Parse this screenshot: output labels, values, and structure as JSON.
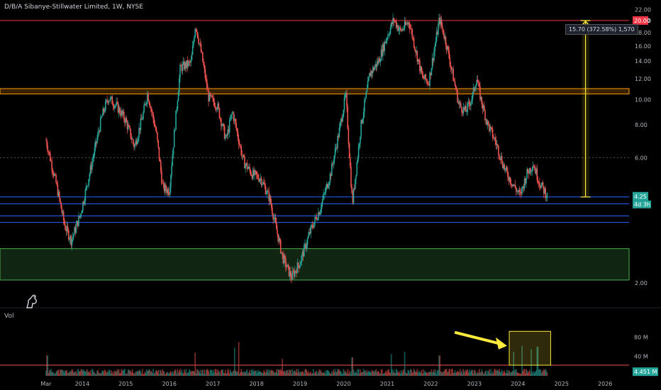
{
  "header": {
    "title": "D/B/A Sibanye-Stillwater Limited, 1W, NYSE"
  },
  "volume_label": "Vol",
  "measure_label": "15.70 (372.58%) 1,570",
  "colors": {
    "background": "#000000",
    "up": "#26a69a",
    "down": "#ef5350",
    "resistance_top": "#f23645",
    "orange_zone": "#ff9800",
    "blue_lines": "#2962ff",
    "green_zone": "#4caf50",
    "arrow": "#ffeb3b",
    "volume_box": "#ffeb3b"
  },
  "chart_data": [
    {
      "type": "candlestick",
      "title": "",
      "x_ticks": [
        "Mar",
        "2014",
        "2015",
        "2016",
        "2017",
        "2018",
        "2019",
        "2020",
        "2021",
        "2022",
        "2023",
        "2024",
        "2025",
        "2026"
      ],
      "x_tick_dates": [
        2013.17,
        2014.0,
        2015.0,
        2016.0,
        2017.0,
        2018.0,
        2019.0,
        2020.0,
        2021.0,
        2022.0,
        2023.0,
        2024.0,
        2025.0,
        2026.0
      ],
      "y_ticks": [
        "22.00",
        "20.00",
        "18.00",
        "16.00",
        "14.00",
        "12.00",
        "10.00",
        "8.00",
        "6.00",
        "4.00",
        "2.00"
      ],
      "y_scale": "log",
      "ylim": [
        1.7,
        22.5
      ],
      "last_price_label": "4.25",
      "countdown_label": "4d 3h",
      "target_label": "20.00",
      "price_path": [
        [
          2013.17,
          7.0
        ],
        [
          2013.4,
          4.8
        ],
        [
          2013.6,
          3.3
        ],
        [
          2013.75,
          2.9
        ],
        [
          2013.95,
          3.6
        ],
        [
          2014.2,
          5.5
        ],
        [
          2014.45,
          8.6
        ],
        [
          2014.6,
          10.2
        ],
        [
          2014.8,
          9.4
        ],
        [
          2015.0,
          8.3
        ],
        [
          2015.2,
          6.6
        ],
        [
          2015.4,
          8.8
        ],
        [
          2015.5,
          10.6
        ],
        [
          2015.7,
          7.5
        ],
        [
          2015.85,
          4.6
        ],
        [
          2016.0,
          4.5
        ],
        [
          2016.1,
          7.0
        ],
        [
          2016.25,
          13.2
        ],
        [
          2016.5,
          13.8
        ],
        [
          2016.6,
          19.5
        ],
        [
          2016.75,
          14.5
        ],
        [
          2016.9,
          10.2
        ],
        [
          2017.1,
          9.5
        ],
        [
          2017.3,
          7.0
        ],
        [
          2017.45,
          9.0
        ],
        [
          2017.7,
          5.8
        ],
        [
          2017.9,
          5.2
        ],
        [
          2018.1,
          5.0
        ],
        [
          2018.3,
          4.2
        ],
        [
          2018.6,
          2.5
        ],
        [
          2018.8,
          2.1
        ],
        [
          2019.0,
          2.4
        ],
        [
          2019.25,
          3.2
        ],
        [
          2019.45,
          3.8
        ],
        [
          2019.7,
          5.2
        ],
        [
          2019.9,
          7.6
        ],
        [
          2020.05,
          10.5
        ],
        [
          2020.2,
          4.0
        ],
        [
          2020.4,
          8.0
        ],
        [
          2020.6,
          12.5
        ],
        [
          2020.8,
          14.0
        ],
        [
          2021.0,
          17.5
        ],
        [
          2021.15,
          20.2
        ],
        [
          2021.3,
          18.2
        ],
        [
          2021.5,
          19.8
        ],
        [
          2021.65,
          15.5
        ],
        [
          2021.8,
          12.2
        ],
        [
          2021.95,
          11.6
        ],
        [
          2022.05,
          14.5
        ],
        [
          2022.2,
          20.3
        ],
        [
          2022.35,
          16.5
        ],
        [
          2022.5,
          12.5
        ],
        [
          2022.65,
          9.5
        ],
        [
          2022.8,
          9.0
        ],
        [
          2022.95,
          10.2
        ],
        [
          2023.05,
          12.1
        ],
        [
          2023.15,
          10.0
        ],
        [
          2023.3,
          8.1
        ],
        [
          2023.5,
          6.8
        ],
        [
          2023.7,
          5.4
        ],
        [
          2023.9,
          4.7
        ],
        [
          2024.05,
          4.3
        ],
        [
          2024.2,
          5.2
        ],
        [
          2024.35,
          5.7
        ],
        [
          2024.5,
          4.8
        ],
        [
          2024.6,
          4.5
        ],
        [
          2024.68,
          4.25
        ]
      ],
      "horizontal_zones": [
        {
          "name": "resistance-top",
          "low": 20.0,
          "high": 20.0,
          "color": "#f23645"
        },
        {
          "name": "orange-zone",
          "low": 10.5,
          "high": 11.0,
          "color": "#ff9800"
        },
        {
          "name": "blue-line-1",
          "low": 4.25,
          "high": 4.25,
          "color": "#2962ff"
        },
        {
          "name": "blue-line-2",
          "low": 4.0,
          "high": 4.0,
          "color": "#2962ff"
        },
        {
          "name": "blue-line-3",
          "low": 3.6,
          "high": 3.6,
          "color": "#2962ff"
        },
        {
          "name": "blue-line-4",
          "low": 3.4,
          "high": 3.4,
          "color": "#2962ff"
        },
        {
          "name": "green-zone",
          "low": 2.05,
          "high": 2.7,
          "color": "#4caf50"
        }
      ],
      "dashed_level": 6.0,
      "measure": {
        "x": 2025.55,
        "from": 4.25,
        "to": 20.0
      }
    },
    {
      "type": "bar",
      "title": "",
      "y_ticks": [
        "80 M",
        "40 M"
      ],
      "ylim": [
        0,
        110
      ],
      "last_volume_label": "4.451 M",
      "volume_level_line": 22,
      "highlight_box": {
        "x_from": 2023.8,
        "x_to": 2024.75,
        "y_from": 22,
        "y_to": 92
      },
      "arrow": {
        "from_x": 2022.55,
        "from_y": 90,
        "to_x": 2023.75,
        "to_y": 62
      },
      "spikes": [
        [
          2013.2,
          42
        ],
        [
          2016.6,
          48
        ],
        [
          2017.5,
          58
        ],
        [
          2017.6,
          70
        ],
        [
          2018.6,
          35
        ],
        [
          2020.2,
          38
        ],
        [
          2021.1,
          45
        ],
        [
          2021.4,
          50
        ],
        [
          2022.2,
          42
        ],
        [
          2023.9,
          50
        ],
        [
          2024.1,
          62
        ],
        [
          2024.3,
          55
        ],
        [
          2024.45,
          60
        ]
      ],
      "base_level": 10
    }
  ]
}
